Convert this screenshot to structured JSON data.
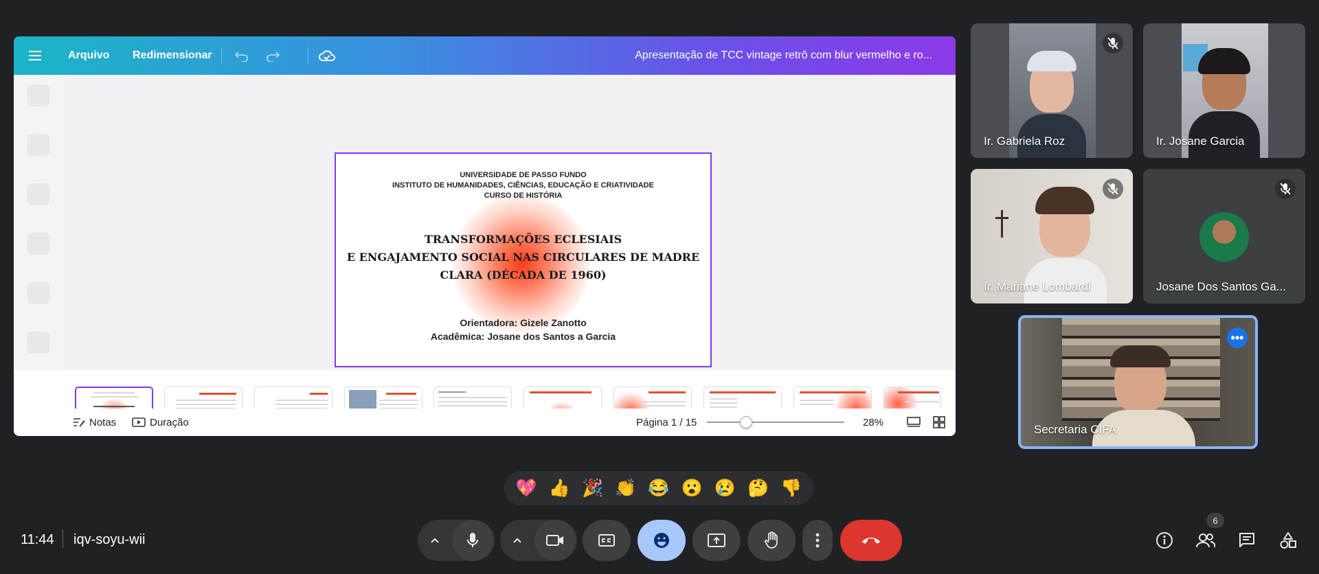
{
  "canva": {
    "menu_label": "Arquivo",
    "resize_label": "Redimensionar",
    "title": "Apresentação de TCC vintage retrô com blur vermelho e ro..."
  },
  "slide": {
    "header": [
      "UNIVERSIDADE DE PASSO FUNDO",
      "INSTITUTO DE HUMANIDADES, CIÊNCIAS, EDUCAÇÃO E CRIATIVIDADE",
      "CURSO DE HISTÓRIA"
    ],
    "title": [
      "TRANSFORMAÇÕES ECLESIAIS",
      "E ENGAJAMENTO SOCIAL NAS CIRCULARES DE MADRE",
      "CLARA (DÉCADA DE 1960)"
    ],
    "footer": [
      "Orientadora: Gizele Zanotto",
      "Acadêmica: Josane dos Santos a Garcia"
    ]
  },
  "thumbnails": [
    "1",
    "2",
    "3",
    "4",
    "5",
    "6",
    "7",
    "8",
    "9",
    "10"
  ],
  "thumbnail_selected": 1,
  "editor_bar": {
    "notes_label": "Notas",
    "duration_label": "Duração",
    "page_label": "Página 1 / 15",
    "zoom_level": "28%",
    "zoom_value": 0.28
  },
  "participants": [
    {
      "name": "Ir. Gabriela Roz",
      "muted": true
    },
    {
      "name": "Ir. Josane Garcia",
      "muted": false
    },
    {
      "name": "Ir. Mariane Lombardi",
      "muted": true
    },
    {
      "name": "Josane Dos Santos Ga...",
      "muted": true
    },
    {
      "name": "Secretaria CIFA",
      "muted": false
    }
  ],
  "reactions": [
    "💖",
    "👍",
    "🎉",
    "👏",
    "😂",
    "😮",
    "😢",
    "🤔",
    "👎"
  ],
  "meeting": {
    "clock": "11:44",
    "code": "iqv-soyu-wii",
    "people_count": "6"
  },
  "colors": {
    "accent": "#a8c7fa",
    "end_call": "#dc362e",
    "canva_selection": "#7d3be8",
    "speaking_border": "#8ab4f8"
  }
}
